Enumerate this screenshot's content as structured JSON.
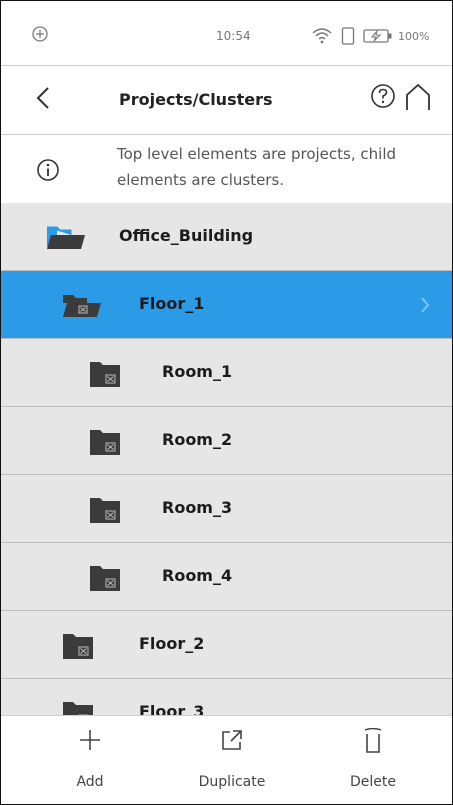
{
  "status_bar": {
    "time": "10:54",
    "battery": "100%",
    "icons": [
      "location-icon",
      "wifi-icon",
      "phone-icon",
      "battery-charging-icon"
    ]
  },
  "header": {
    "title": "Projects/Clusters",
    "icons": [
      "back-icon",
      "help-icon",
      "home-icon"
    ]
  },
  "info": {
    "text": "Top level elements are projects, child elements are clusters.",
    "icon": "info-icon"
  },
  "tree": {
    "items": [
      {
        "label": "Office_Building",
        "level": 0,
        "type": "project",
        "selected": false
      },
      {
        "label": "Floor_1",
        "level": 1,
        "type": "cluster",
        "selected": true
      },
      {
        "label": "Room_1",
        "level": 2,
        "type": "cluster",
        "selected": false
      },
      {
        "label": "Room_2",
        "level": 2,
        "type": "cluster",
        "selected": false
      },
      {
        "label": "Room_3",
        "level": 2,
        "type": "cluster",
        "selected": false
      },
      {
        "label": "Room_4",
        "level": 2,
        "type": "cluster",
        "selected": false
      },
      {
        "label": "Floor_2",
        "level": 1,
        "type": "cluster",
        "selected": false
      },
      {
        "label": "Floor_3",
        "level": 1,
        "type": "cluster",
        "selected": false
      }
    ]
  },
  "toolbar": {
    "add_label": "Add",
    "duplicate_label": "Duplicate",
    "delete_label": "Delete"
  },
  "colors": {
    "selected_row": "#2b9be8",
    "row_background": "#e6e6e6",
    "folder_blue": "#2b9be8",
    "folder_dark": "#3b3b3b"
  }
}
